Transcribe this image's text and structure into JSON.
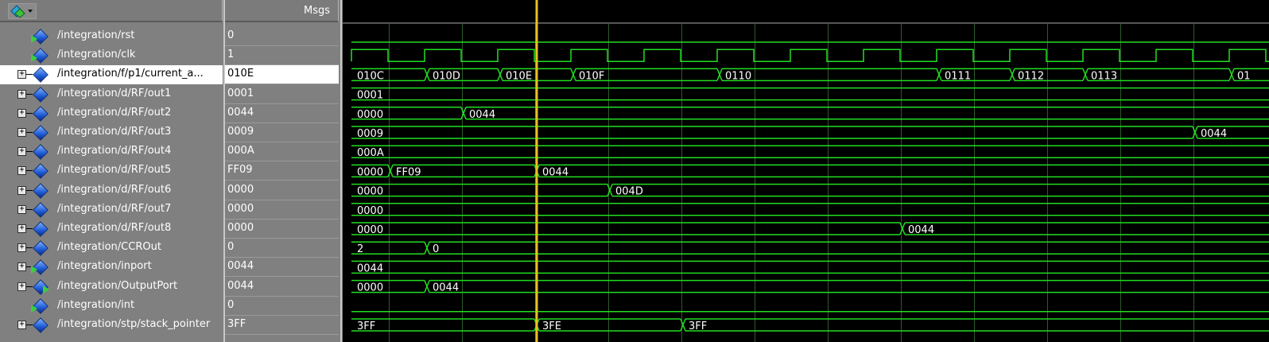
{
  "header": {
    "msgs_label": "Msgs",
    "toolbar_icon": "wave-tool-icon"
  },
  "colors": {
    "wave": "#22dd22",
    "cursor": "#e8c020",
    "text": "#ffffff",
    "bg": "#000000",
    "grid": "#2d5a2d"
  },
  "signals": [
    {
      "name": "/integration/rst",
      "value": "0",
      "kind": "input-bit"
    },
    {
      "name": "/integration/clk",
      "value": "1",
      "kind": "input-bit"
    },
    {
      "name": "/integration/f/p1/current_a...",
      "value": "010E",
      "kind": "bus",
      "selected": true
    },
    {
      "name": "/integration/d/RF/out1",
      "value": "0001",
      "kind": "bus"
    },
    {
      "name": "/integration/d/RF/out2",
      "value": "0044",
      "kind": "bus"
    },
    {
      "name": "/integration/d/RF/out3",
      "value": "0009",
      "kind": "bus"
    },
    {
      "name": "/integration/d/RF/out4",
      "value": "000A",
      "kind": "bus"
    },
    {
      "name": "/integration/d/RF/out5",
      "value": "FF09",
      "kind": "bus"
    },
    {
      "name": "/integration/d/RF/out6",
      "value": "0000",
      "kind": "bus"
    },
    {
      "name": "/integration/d/RF/out7",
      "value": "0000",
      "kind": "bus"
    },
    {
      "name": "/integration/d/RF/out8",
      "value": "0000",
      "kind": "bus"
    },
    {
      "name": "/integration/CCROut",
      "value": "0",
      "kind": "bus"
    },
    {
      "name": "/integration/inport",
      "value": "0044",
      "kind": "input-bus"
    },
    {
      "name": "/integration/OutputPort",
      "value": "0044",
      "kind": "output-bus"
    },
    {
      "name": "/integration/int",
      "value": "0",
      "kind": "input-bit"
    },
    {
      "name": "/integration/stp/stack_pointer",
      "value": "3FF",
      "kind": "bus"
    }
  ],
  "waves": [
    {
      "type": "bit",
      "level": 0
    },
    {
      "type": "clock"
    },
    {
      "type": "bus",
      "segments": [
        {
          "start": 0,
          "label": "010C"
        },
        {
          "start": 1,
          "label": "010D"
        },
        {
          "start": 2,
          "label": "010E"
        },
        {
          "start": 3,
          "label": "010F"
        },
        {
          "start": 5,
          "label": "0110"
        },
        {
          "start": 8,
          "label": "0111"
        },
        {
          "start": 9,
          "label": "0112"
        },
        {
          "start": 10,
          "label": "0113"
        },
        {
          "start": 12,
          "label": "01"
        }
      ]
    },
    {
      "type": "bus",
      "segments": [
        {
          "start": 0,
          "label": "0001"
        }
      ]
    },
    {
      "type": "bus",
      "segments": [
        {
          "start": 0,
          "label": "0000"
        },
        {
          "start": 1.5,
          "label": "0044"
        }
      ]
    },
    {
      "type": "bus",
      "segments": [
        {
          "start": 0,
          "label": "0009"
        },
        {
          "start": 11.5,
          "label": "0044"
        }
      ]
    },
    {
      "type": "bus",
      "segments": [
        {
          "start": 0,
          "label": "000A"
        }
      ]
    },
    {
      "type": "bus",
      "segments": [
        {
          "start": 0,
          "label": "0000"
        },
        {
          "start": 0.5,
          "label": "FF09"
        },
        {
          "start": 2.5,
          "label": "0044"
        }
      ]
    },
    {
      "type": "bus",
      "segments": [
        {
          "start": 0,
          "label": "0000"
        },
        {
          "start": 3.5,
          "label": "004D"
        }
      ]
    },
    {
      "type": "bus",
      "segments": [
        {
          "start": 0,
          "label": "0000"
        }
      ]
    },
    {
      "type": "bus",
      "segments": [
        {
          "start": 0,
          "label": "0000"
        },
        {
          "start": 7.5,
          "label": "0044"
        }
      ]
    },
    {
      "type": "bus",
      "segments": [
        {
          "start": 0,
          "label": "2"
        },
        {
          "start": 1,
          "label": "0"
        }
      ]
    },
    {
      "type": "bus",
      "segments": [
        {
          "start": 0,
          "label": "0044"
        }
      ]
    },
    {
      "type": "bus",
      "segments": [
        {
          "start": 0,
          "label": "0000"
        },
        {
          "start": 1,
          "label": "0044"
        }
      ]
    },
    {
      "type": "bit",
      "level": 0
    },
    {
      "type": "bus",
      "segments": [
        {
          "start": 0,
          "label": "3FF"
        },
        {
          "start": 2.5,
          "label": "3FE"
        },
        {
          "start": 4.5,
          "label": "3FF"
        }
      ]
    }
  ]
}
